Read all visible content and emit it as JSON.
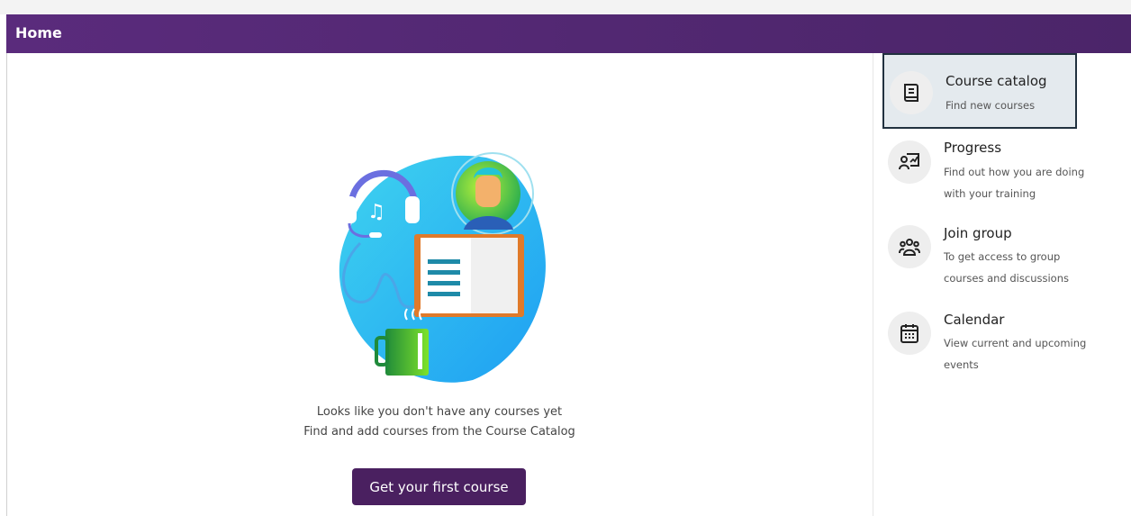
{
  "header": {
    "title": "Home"
  },
  "main": {
    "message_line1": "Looks like you don't have any courses yet",
    "message_line2": "Find and add courses from the Course Catalog",
    "cta_label": "Get your first course"
  },
  "sidebar": {
    "items": [
      {
        "title": "Course catalog",
        "subtitle": "Find new courses",
        "icon": "book-icon",
        "active": true
      },
      {
        "title": "Progress",
        "subtitle": "Find out how you are doing with your training",
        "icon": "progress-chart-icon",
        "active": false
      },
      {
        "title": "Join group",
        "subtitle": "To get access to group courses and discussions",
        "icon": "group-icon",
        "active": false
      },
      {
        "title": "Calendar",
        "subtitle": "View current and upcoming events",
        "icon": "calendar-icon",
        "active": false
      }
    ]
  },
  "colors": {
    "header": "#5a2b7c",
    "button": "#4a2060",
    "active_border": "#21313f",
    "active_bg": "#e4eaee"
  }
}
